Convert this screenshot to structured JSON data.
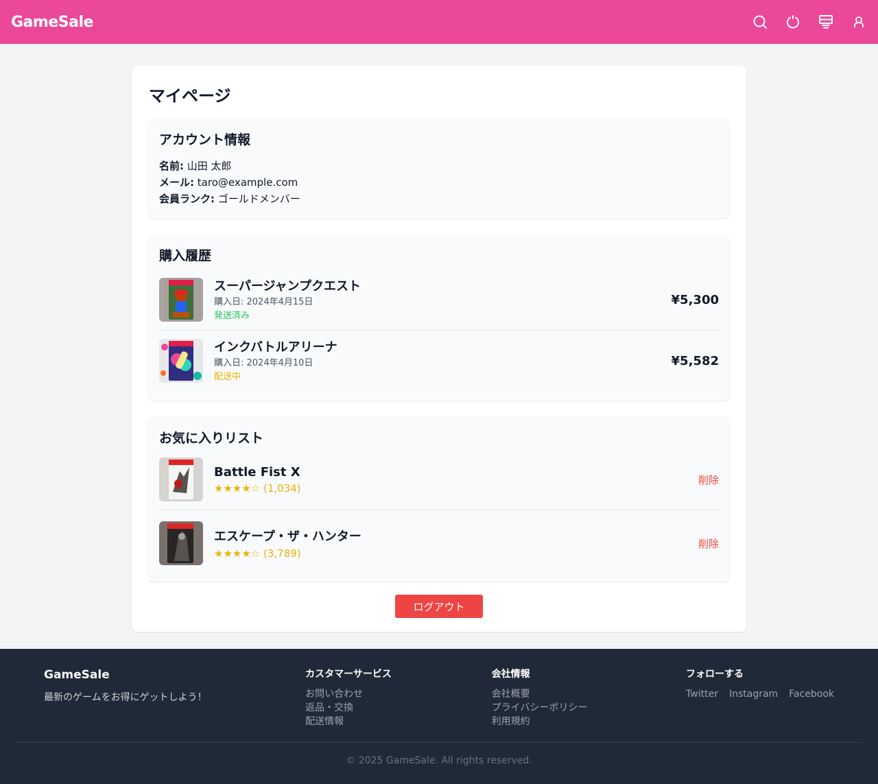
{
  "header": {
    "logo": "GameSale",
    "icons": [
      "search-icon",
      "power-icon",
      "cart-icon",
      "user-icon"
    ]
  },
  "page": {
    "title": "マイページ"
  },
  "account": {
    "heading": "アカウント情報",
    "name_label": "名前:",
    "name_value": "山田 太郎",
    "email_label": "メール:",
    "email_value": "taro@example.com",
    "rank_label": "会員ランク:",
    "rank_value": "ゴールドメンバー"
  },
  "purchases": {
    "heading": "購入履歴",
    "items": [
      {
        "title": "スーパージャンプクエスト",
        "date": "購入日: 2024年4月15日",
        "status": "発送済み",
        "price": "¥5,300"
      },
      {
        "title": "インクバトルアリーナ",
        "date": "購入日: 2024年4月10日",
        "status": "配送中",
        "price": "¥5,582"
      }
    ]
  },
  "favorites": {
    "heading": "お気に入りリスト",
    "items": [
      {
        "title": "Battle Fist X",
        "rating": "★★★★☆ (1,034)",
        "remove": "削除"
      },
      {
        "title": "エスケープ・ザ・ハンター",
        "rating": "★★★★☆ (3,789)",
        "remove": "削除"
      }
    ]
  },
  "logout_label": "ログアウト",
  "footer": {
    "brand": "GameSale",
    "tagline": "最新のゲームをお得にゲットしよう！",
    "service": {
      "heading": "カスタマーサービス",
      "links": [
        "お問い合わせ",
        "返品・交換",
        "配送情報"
      ]
    },
    "company": {
      "heading": "会社情報",
      "links": [
        "会社概要",
        "プライバシーポリシー",
        "利用規約"
      ]
    },
    "follow": {
      "heading": "フォローする",
      "links": [
        "Twitter",
        "Instagram",
        "Facebook"
      ]
    },
    "copyright": "© 2025 GameSale. All rights reserved."
  },
  "colors": {
    "brand": "#ec4899",
    "shipped": "#22c55e",
    "shipping": "#eab308",
    "danger": "#ef4444",
    "footer_bg": "#1f2937"
  }
}
